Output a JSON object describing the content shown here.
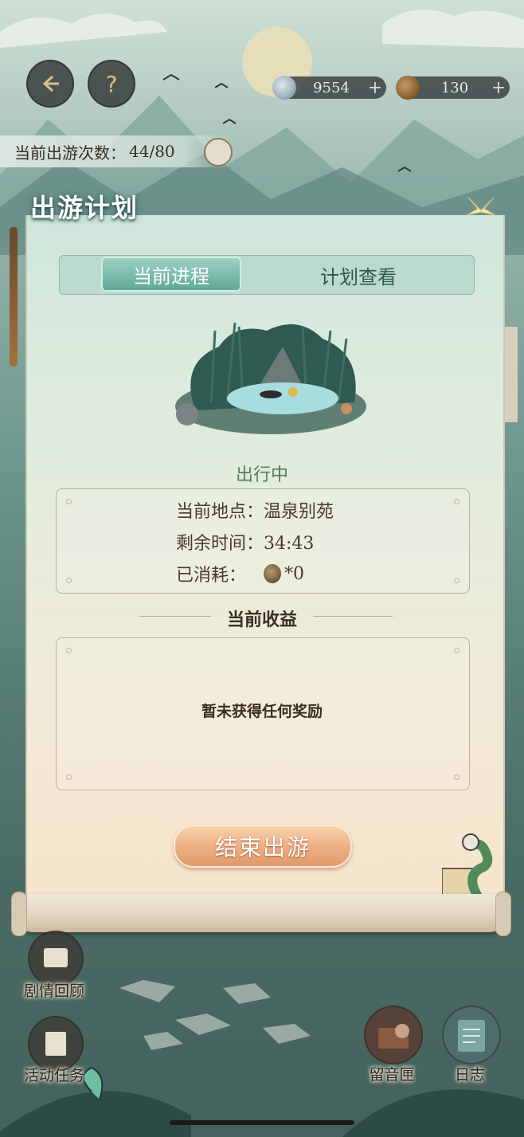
{
  "currencies": [
    {
      "icon": "spiral-shell-coin-icon",
      "value": "9554",
      "plus": "+"
    },
    {
      "icon": "bronze-coin-icon",
      "value": "130",
      "plus": "+"
    }
  ],
  "outing_count": {
    "label": "当前出游次数：",
    "value": "44/80"
  },
  "panel": {
    "title": "出游计划",
    "tabs": [
      {
        "label": "当前进程",
        "active": true
      },
      {
        "label": "计划查看",
        "active": false
      }
    ],
    "status": "出行中",
    "info": {
      "location_label": "当前地点：",
      "location_value": "温泉别苑",
      "time_label": "剩余时间：",
      "time_value": "34:43",
      "cost_label": "已消耗：",
      "cost_value": "*0"
    },
    "rewards_title": "当前收益",
    "rewards_empty": "暂未获得任何奖励",
    "end_button": "结束出游"
  },
  "bottom_nav": [
    {
      "label": "剧情回顾",
      "icon": "scroll-icon"
    },
    {
      "label": "活动任务",
      "icon": "quest-book-icon"
    },
    {
      "label": "留音匣",
      "icon": "music-box-icon"
    },
    {
      "label": "日志",
      "icon": "journal-icon"
    }
  ],
  "colors": {
    "accent_green": "#5fa998",
    "button_orange": "#eeb085",
    "text_brown": "#3b2e22"
  }
}
